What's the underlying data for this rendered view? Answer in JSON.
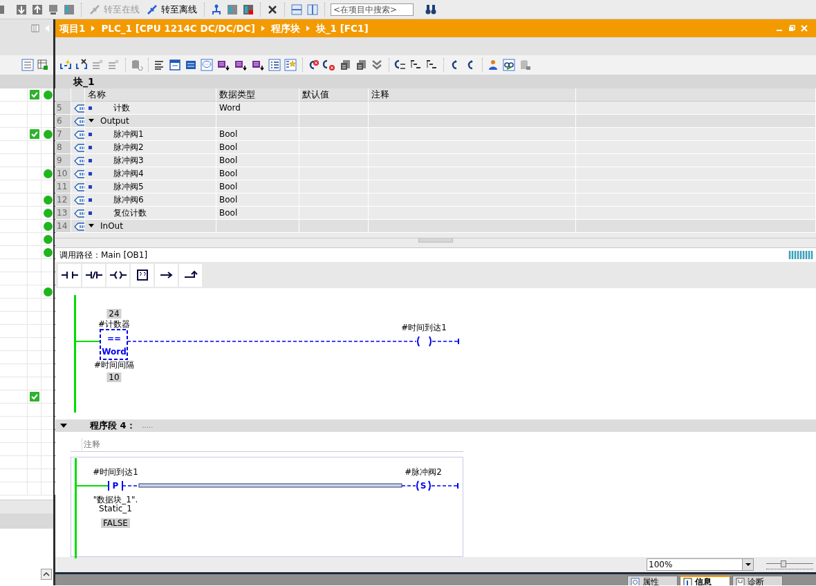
{
  "toolbar": {
    "buttons": [
      {
        "label": "转至在线",
        "disabled": true
      },
      {
        "label": "转至离线",
        "disabled": false
      }
    ],
    "search": {
      "placeholder": "<在项目中搜索>"
    }
  },
  "breadcrumb": [
    "项目1",
    "PLC_1 [CPU 1214C DC/DC/DC]",
    "程序块",
    "块_1 [FC1]"
  ],
  "project_tree": {
    "rows": [
      {
        "checked": true,
        "status_ok": true
      },
      {
        "checked": false,
        "status_ok": false
      },
      {
        "checked": false,
        "status_ok": false
      },
      {
        "checked": true,
        "status_ok": true
      },
      {
        "checked": false,
        "status_ok": false
      },
      {
        "checked": false,
        "status_ok": false
      },
      {
        "checked": false,
        "status_ok": true
      },
      {
        "checked": false,
        "status_ok": false
      },
      {
        "checked": false,
        "status_ok": true
      },
      {
        "checked": false,
        "status_ok": true
      },
      {
        "checked": false,
        "status_ok": true
      },
      {
        "checked": false,
        "status_ok": true
      },
      {
        "checked": false,
        "status_ok": true
      },
      {
        "checked": false,
        "status_ok": false
      },
      {
        "checked": false,
        "status_ok": false
      },
      {
        "checked": false,
        "status_ok": true
      },
      {
        "checked": false,
        "status_ok": false
      },
      {
        "checked": false,
        "status_ok": false
      },
      {
        "checked": false,
        "status_ok": false
      },
      {
        "checked": false,
        "status_ok": false
      },
      {
        "checked": false,
        "status_ok": false
      },
      {
        "checked": false,
        "status_ok": false
      },
      {
        "checked": false,
        "status_ok": false
      },
      {
        "checked": true,
        "status_ok": false
      },
      {
        "checked": false,
        "status_ok": false
      },
      {
        "checked": false,
        "status_ok": false
      },
      {
        "checked": false,
        "status_ok": false
      },
      {
        "checked": false,
        "status_ok": false
      },
      {
        "checked": false,
        "status_ok": false
      },
      {
        "checked": false,
        "status_ok": false
      },
      {
        "checked": false,
        "status_ok": false
      }
    ]
  },
  "interface": {
    "title": "块_1",
    "columns": [
      "名称",
      "数据类型",
      "默认值",
      "注释"
    ],
    "rows": [
      {
        "number": "5",
        "kind": "variable",
        "name": "计数",
        "data_type": "Word"
      },
      {
        "number": "6",
        "kind": "section",
        "name": "Output",
        "expanded": true
      },
      {
        "number": "7",
        "kind": "variable",
        "name": "脉冲阀1",
        "data_type": "Bool"
      },
      {
        "number": "8",
        "kind": "variable",
        "name": "脉冲阀2",
        "data_type": "Bool"
      },
      {
        "number": "9",
        "kind": "variable",
        "name": "脉冲阀3",
        "data_type": "Bool"
      },
      {
        "number": "10",
        "kind": "variable",
        "name": "脉冲阀4",
        "data_type": "Bool"
      },
      {
        "number": "11",
        "kind": "variable",
        "name": "脉冲阀5",
        "data_type": "Bool"
      },
      {
        "number": "12",
        "kind": "variable",
        "name": "脉冲阀6",
        "data_type": "Bool"
      },
      {
        "number": "13",
        "kind": "variable",
        "name": "复位计数",
        "data_type": "Bool"
      },
      {
        "number": "14",
        "kind": "section",
        "name": "InOut",
        "expanded": true
      }
    ]
  },
  "editor": {
    "call_path": "调用路径：Main [OB1]",
    "networks": [
      {
        "input": {
          "kind": "compare",
          "top_value": "24",
          "operand": "#计数器",
          "operator": "==",
          "data_type": "Word",
          "operand_2": "#时间间隔",
          "bottom_value": "10"
        },
        "output": {
          "kind": "coil",
          "operand": "#时间到达1"
        }
      },
      {
        "title": "程序段 4：",
        "title_comment": ".....",
        "expanded": true,
        "comment": {
          "placeholder": "注释"
        },
        "input": {
          "kind": "edge_contact",
          "letter": "P",
          "operand": "#时间到达1",
          "edge_operand": "\"数据块_1\".",
          "edge_operand_2": "Static_1",
          "value": "FALSE"
        },
        "output": {
          "kind": "set_coil",
          "letter": "S",
          "operand": "#脉冲阀2"
        }
      }
    ]
  },
  "zoom": {
    "value": "100%",
    "level": 0.37
  },
  "bottom_tabs": [
    {
      "label": "属性",
      "selected": false
    },
    {
      "label": "信息",
      "selected": true
    },
    {
      "label": "诊断",
      "selected": false
    }
  ]
}
